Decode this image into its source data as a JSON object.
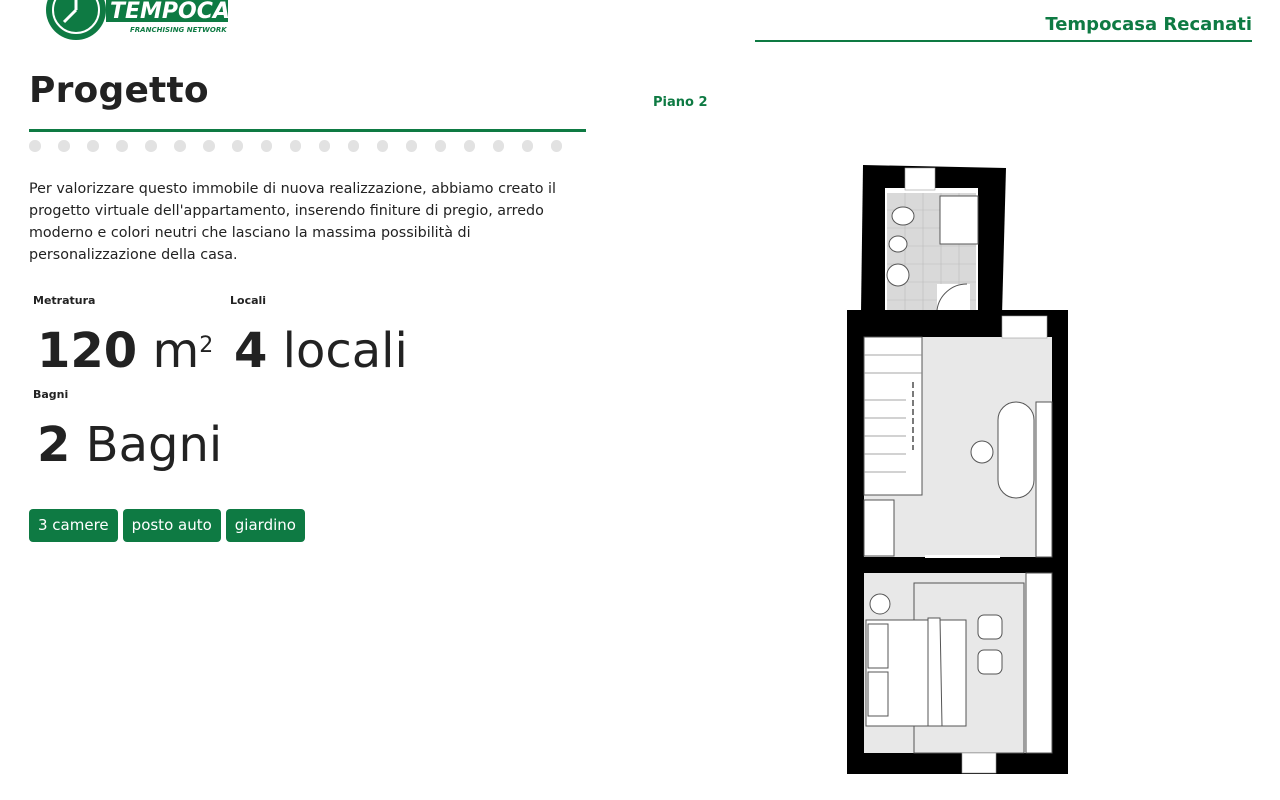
{
  "brand": {
    "logo_text": "TEMPOCASA",
    "logo_subtext": "FRANCHISING NETWORK",
    "agency_name": "Tempocasa Recanati",
    "color": "#0e7a43"
  },
  "section": {
    "title": "Progetto",
    "description": "Per valorizzare questo immobile di nuova realizzazione, abbiamo creato il progetto virtuale dell'appartamento, inserendo finiture di pregio, arredo moderno e colori neutri che lasciano la massima possibilità di personalizzazione della casa."
  },
  "stats": {
    "metratura": {
      "label": "Metratura",
      "value": "120",
      "unit": "m",
      "unit_sup": "2"
    },
    "locali": {
      "label": "Locali",
      "value": "4",
      "unit": "locali"
    },
    "bagni": {
      "label": "Bagni",
      "value": "2",
      "unit": "Bagni"
    }
  },
  "tags": [
    "3 camere",
    "posto auto",
    "giardino"
  ],
  "floor_plan": {
    "label": "Piano 2"
  }
}
